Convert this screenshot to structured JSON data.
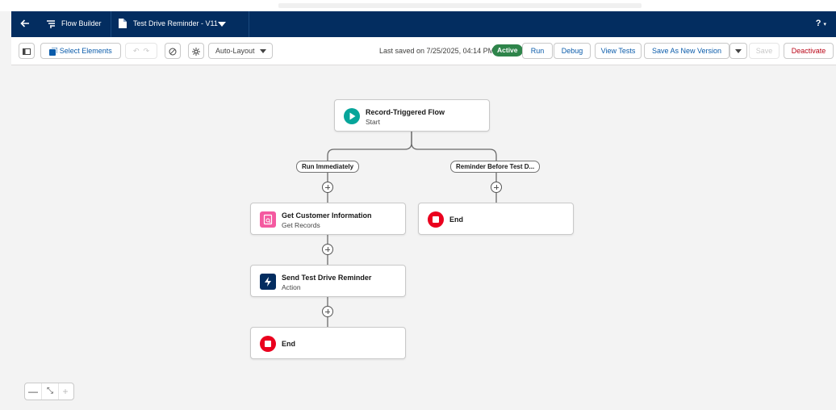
{
  "header": {
    "app_name": "Flow Builder",
    "flow_name": "Test Drive Reminder - V11",
    "help_label": "?"
  },
  "toolbar": {
    "select_elements": "Select Elements",
    "layout_mode": "Auto-Layout",
    "last_saved": "Last saved on 7/25/2025, 04:14 PM",
    "status_badge": "Active",
    "run": "Run",
    "debug": "Debug",
    "view_tests": "View Tests",
    "save_as_new_version": "Save As New Version",
    "save": "Save",
    "deactivate": "Deactivate"
  },
  "canvas": {
    "start_node": {
      "title": "Record-Triggered Flow",
      "subtitle": "Start"
    },
    "paths": [
      {
        "label": "Run Immediately"
      },
      {
        "label": "Reminder Before Test D..."
      }
    ],
    "left_nodes": [
      {
        "title": "Get Customer Information",
        "subtitle": "Get Records"
      },
      {
        "title": "Send Test Drive Reminder",
        "subtitle": "Action"
      },
      {
        "title": "End",
        "subtitle": ""
      }
    ],
    "right_nodes": [
      {
        "title": "End",
        "subtitle": ""
      }
    ]
  },
  "zoom": {
    "out": "—",
    "fit": "⤡",
    "in": "+"
  },
  "colors": {
    "header_bg": "#032d60",
    "accent": "#0b5cab",
    "active_green": "#2e844a",
    "start_icon": "#06a59a",
    "get_records_icon": "#f45aa0",
    "action_icon": "#032d60",
    "end_icon": "#ea001e",
    "deactivate_text": "#ba0517"
  },
  "icons": [
    "back-arrow-icon",
    "flow-builder-icon",
    "file-icon",
    "chevron-down-icon",
    "panel-toggle-icon",
    "select-elements-icon",
    "undo-icon",
    "redo-icon",
    "ban-icon",
    "gear-icon",
    "play-icon",
    "get-records-icon",
    "lightning-icon",
    "stop-icon",
    "plus-icon"
  ]
}
